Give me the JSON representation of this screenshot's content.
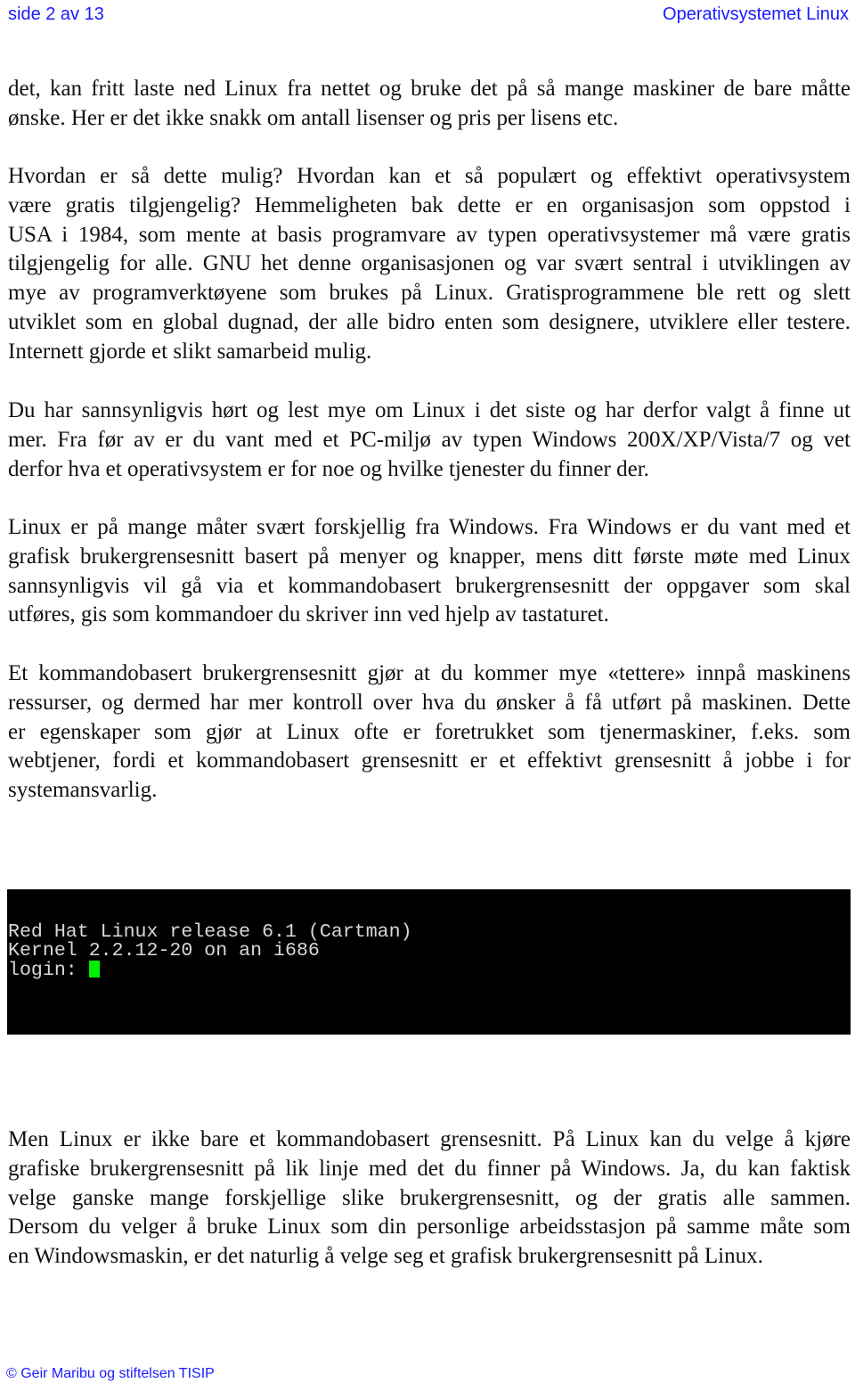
{
  "header": {
    "page": "side 2 av 13",
    "title": "Operativsystemet Linux"
  },
  "paragraphs": [
    [
      "det, kan fritt laste ned Linux fra nettet og bruke det på så mange maskiner de bare måtte",
      "ønske. Her er det ikke snakk om antall lisenser og pris per lisens etc."
    ],
    [
      "Hvordan er så dette mulig? Hvordan kan et så populært og effektivt operativsystem",
      "være gratis tilgjengelig? Hemmeligheten bak dette er en organisasjon som oppstod i",
      "USA i 1984, som mente at basis programvare av typen operativsystemer må være gratis",
      "tilgjengelig for alle. GNU het denne organisasjonen og var svært sentral i utviklingen av",
      "mye av programverktøyene som brukes på Linux. Gratisprogrammene ble rett og slett",
      "utviklet som en global dugnad, der alle bidro enten som designere, utviklere eller testere.",
      "Internett gjorde et slikt samarbeid mulig."
    ],
    [
      "Du har sannsynligvis hørt og lest mye om Linux i det siste og har derfor valgt å finne ut",
      "mer. Fra før av er du vant med et PC-miljø av typen Windows 200X/XP/Vista/7 og vet",
      "derfor hva et operativsystem er for noe og hvilke tjenester du finner der."
    ],
    [
      "Linux er på mange måter svært forskjellig fra Windows. Fra Windows er du vant med et",
      "grafisk brukergrensesnitt basert på menyer og knapper, mens ditt første møte med Linux",
      "sannsynligvis vil gå via et kommandobasert brukergrensesnitt der oppgaver som skal",
      "utføres, gis som kommandoer du skriver inn ved hjelp av tastaturet."
    ],
    [
      "Et kommandobasert brukergrensesnitt gjør at du kommer mye «tettere» innpå maskinens",
      "ressurser, og dermed har mer kontroll over hva du ønsker å få utført på maskinen. Dette",
      "er egenskaper som gjør at Linux ofte er foretrukket som tjenermaskiner, f.eks. som",
      "webtjener, fordi et kommandobasert grensesnitt er et effektivt grensesnitt å jobbe i for",
      "systemansvarlig."
    ],
    [
      "Men Linux er ikke bare et kommandobasert grensesnitt. På Linux kan du velge å kjøre",
      "grafiske brukergrensesnitt på lik linje med det du finner på Windows. Ja, du kan faktisk",
      "velge ganske mange forskjellige slike brukergrensesnitt, og der gratis alle sammen.",
      "Dersom du velger å bruke Linux som din personlige arbeidsstasjon på samme måte som",
      "en Windowsmaskin, er det naturlig å velge seg et grafisk brukergrensesnitt på Linux."
    ]
  ],
  "terminal": {
    "lines": [
      "Red Hat Linux release 6.1 (Cartman)",
      "Kernel 2.2.12-20 on an i686",
      "login: "
    ],
    "cursor_color": "#00ee00"
  },
  "footer": {
    "copyright": "© Geir Maribu og stiftelsen TISIP"
  }
}
